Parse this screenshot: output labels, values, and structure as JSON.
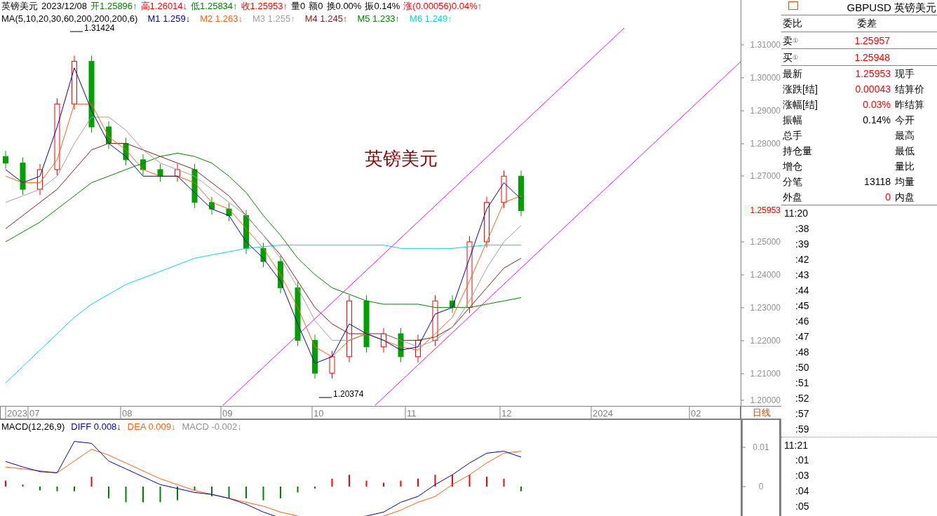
{
  "quote_bar": {
    "symbol": "英镑美元",
    "date": "2023/12/08",
    "fields": [
      {
        "text": "开1.25896↑",
        "color": "#008000"
      },
      {
        "text": "高1.26014↓",
        "color": "#ff0000"
      },
      {
        "text": "低1.25834↑",
        "color": "#008000"
      },
      {
        "text": "收1.25953↑",
        "color": "#ff0000"
      },
      {
        "text": "量0"
      },
      {
        "text": "额0"
      },
      {
        "text": "换0.00%"
      },
      {
        "text": "振0.14%"
      },
      {
        "text": "涨(0.00056)0.04%↑",
        "color": "#ff0000"
      }
    ]
  },
  "ma_bar": {
    "label": "MA(5,10,20,30,60,200,200,200,6)",
    "items": [
      {
        "name": "M1",
        "value": "1.259↓",
        "color": "#0000a0"
      },
      {
        "name": "M2",
        "value": "1.263↓",
        "color": "#ff6010"
      },
      {
        "name": "M3",
        "value": "1.255↑",
        "color": "#a0a0a0"
      },
      {
        "name": "M4",
        "value": "1.245↑",
        "color": "#8b1a1a"
      },
      {
        "name": "M5",
        "value": "1.233↑",
        "color": "#008000"
      },
      {
        "name": "M6",
        "value": "1.249↑",
        "color": "#00d8e8"
      }
    ]
  },
  "main_chart": {
    "title": "英镑美元",
    "annotations": [
      "1.31424",
      "1.20374"
    ],
    "price_labels": [
      "1.31000",
      "1.30000",
      "1.29000",
      "1.28000",
      "1.27000",
      "1.25000",
      "1.24000",
      "1.23000",
      "1.22000",
      "1.21000",
      "1.20000"
    ],
    "last_price": "1.25953",
    "time_labels": [
      "2023",
      "07",
      "08",
      "09",
      "10",
      "11",
      "12",
      "2024",
      "02"
    ],
    "period_button": "日线"
  },
  "macd_bar": {
    "items": [
      {
        "text": "MACD(12,26,9)",
        "color": "#000000"
      },
      {
        "text": "DIFF 0.008↓",
        "color": "#0000a0"
      },
      {
        "text": "DEA 0.009↓",
        "color": "#ff6010"
      },
      {
        "text": "MACD -0.002↓",
        "color": "#909090"
      }
    ]
  },
  "macd_chart": {
    "axis_labels": [
      "0.01",
      "0"
    ]
  },
  "panel": {
    "title": "GBPUSD 英镑美元",
    "ratio": {
      "left": "委比",
      "right": "委差"
    },
    "orders": [
      {
        "label": "卖",
        "mark": "①",
        "price": "1.25957"
      },
      {
        "label": "买",
        "mark": "①",
        "price": "1.25948"
      }
    ],
    "stats": [
      {
        "label": "最新",
        "value": "1.25953",
        "color": "#ff0000",
        "label2": "现手"
      },
      {
        "label": "涨跌[结]",
        "value": "0.00043",
        "color": "#ff0000",
        "label2": "结算价"
      },
      {
        "label": "涨幅[结]",
        "value": "0.03%",
        "color": "#ff0000",
        "label2": "昨结算"
      },
      {
        "label": "振幅",
        "value": "0.14%",
        "color": "#000000",
        "label2": "今开"
      },
      {
        "label": "总手",
        "label2": "最高"
      },
      {
        "label": "持仓量",
        "label2": "最低"
      },
      {
        "label": "增仓",
        "label2": "量比"
      },
      {
        "label": "分笔",
        "value": "13118",
        "color": "#000000",
        "label2": "均量"
      },
      {
        "label": "外盘",
        "value": "0",
        "color": "#ff0000",
        "label2": "内盘"
      }
    ],
    "ticks": [
      {
        "time": "11:20",
        "kind": "hour"
      },
      {
        "time": ":38",
        "kind": "minute"
      },
      {
        "time": ":39",
        "kind": "minute"
      },
      {
        "time": ":42",
        "kind": "minute"
      },
      {
        "time": ":43",
        "kind": "minute"
      },
      {
        "time": ":44",
        "kind": "minute"
      },
      {
        "time": ":45",
        "kind": "minute"
      },
      {
        "time": ":46",
        "kind": "minute"
      },
      {
        "time": ":47",
        "kind": "minute"
      },
      {
        "time": ":48",
        "kind": "minute"
      },
      {
        "time": ":50",
        "kind": "minute"
      },
      {
        "time": ":51",
        "kind": "minute"
      },
      {
        "time": ":52",
        "kind": "minute"
      },
      {
        "time": ":57",
        "kind": "minute"
      },
      {
        "time": ":59",
        "kind": "minute"
      },
      {
        "time": "11:21",
        "kind": "hour"
      },
      {
        "time": ":01",
        "kind": "minute"
      },
      {
        "time": ":03",
        "kind": "minute"
      },
      {
        "time": ":04",
        "kind": "minute"
      },
      {
        "time": ":05",
        "kind": "minute"
      }
    ]
  }
}
